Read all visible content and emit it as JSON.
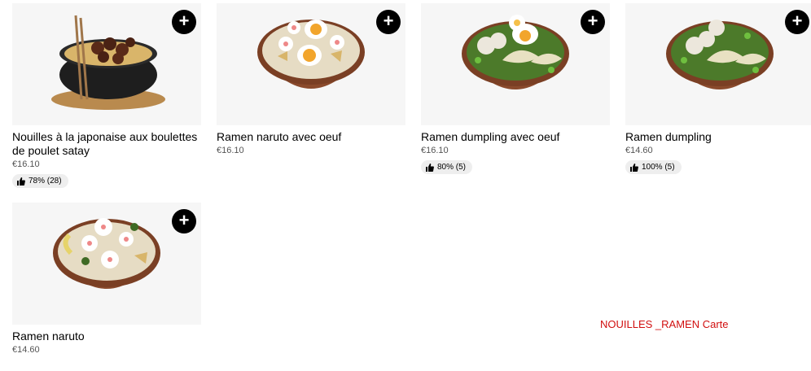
{
  "items": [
    {
      "name": "Nouilles à la japonaise aux boulettes de poulet satay",
      "price": "€16.10",
      "rating": "78% (28)"
    },
    {
      "name": "Ramen naruto avec oeuf",
      "price": "€16.10",
      "rating": ""
    },
    {
      "name": "Ramen dumpling avec oeuf",
      "price": "€16.10",
      "rating": "80% (5)"
    },
    {
      "name": "Ramen dumpling",
      "price": "€14.60",
      "rating": "100% (5)"
    },
    {
      "name": "Ramen naruto",
      "price": "€14.60",
      "rating": ""
    }
  ],
  "add_symbol": "+",
  "caption": "NOUILLES _RAMEN Carte",
  "colors": {
    "caption": "#d10f0f",
    "button": "#000000",
    "rating_bg": "#eeeeee",
    "price": "#545454"
  }
}
